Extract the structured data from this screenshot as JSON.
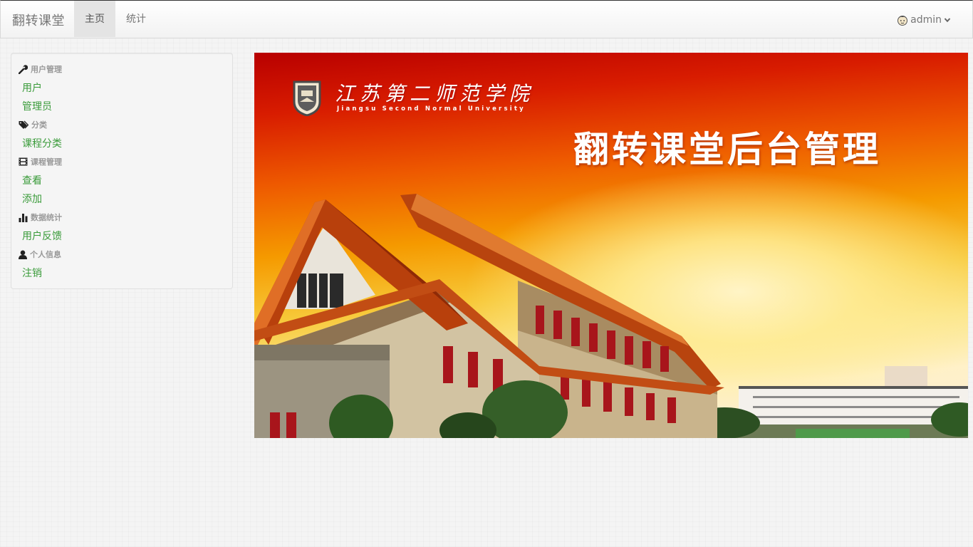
{
  "navbar": {
    "brand": "翻转课堂",
    "tabs": [
      {
        "label": "主页",
        "active": true
      },
      {
        "label": "统计",
        "active": false
      }
    ],
    "user": {
      "name": "admin",
      "avatar_icon": "user-avatar-icon",
      "caret_icon": "chevron-down-icon"
    }
  },
  "sidebar": {
    "sections": [
      {
        "title": "用户管理",
        "icon": "wrench-icon",
        "items": [
          "用户",
          "管理员"
        ]
      },
      {
        "title": "分类",
        "icon": "tags-icon",
        "items": [
          "课程分类"
        ]
      },
      {
        "title": "课程管理",
        "icon": "film-icon",
        "items": [
          "查看",
          "添加"
        ]
      },
      {
        "title": "数据统计",
        "icon": "bar-chart-icon",
        "items": [
          "用户反馈"
        ]
      },
      {
        "title": "个人信息",
        "icon": "user-icon",
        "items": [
          "注销"
        ]
      }
    ]
  },
  "banner": {
    "school_cn": "江苏第二师范学院",
    "school_en": "Jiangsu  Second  Normal  University",
    "title": "翻转课堂后台管理",
    "logo_icon": "university-seal-icon"
  },
  "colors": {
    "link": "#3a9b3a",
    "nav_text": "#777777",
    "banner_red": "#c80000",
    "banner_orange": "#f59a00"
  }
}
